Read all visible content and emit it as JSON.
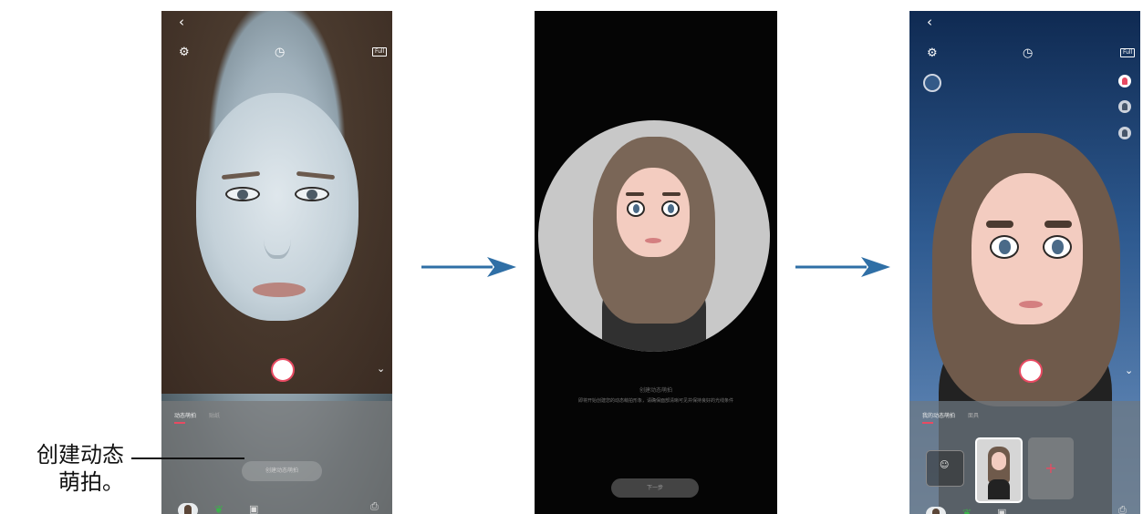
{
  "annotation": {
    "text_line1": "创建动态",
    "text_line2": "萌拍。"
  },
  "screen1": {
    "back_icon": "‹",
    "settings_icon": "⚙",
    "timer_icon": "◷",
    "full_label": "Full",
    "tabs": [
      "动态萌拍",
      "贴纸"
    ],
    "create_button": "创建动态萌拍",
    "chevron": "⌄",
    "gallery_icon": "⎙"
  },
  "screen2": {
    "title_text": "创建动态萌拍",
    "body_text": "即将开始创建您的动态萌拍形象，请确保面部清晰可见并保持良好的光线条件",
    "next_button": "下一步"
  },
  "screen3": {
    "back_icon": "‹",
    "settings_icon": "⚙",
    "timer_icon": "◷",
    "full_label": "Full",
    "tabs": [
      "我的动态萌拍",
      "面具"
    ],
    "add_label": "+",
    "chevron": "⌄",
    "gallery_icon": "⎙"
  },
  "colors": {
    "accent": "#e84a62",
    "arrow": "#2f6fa6"
  }
}
